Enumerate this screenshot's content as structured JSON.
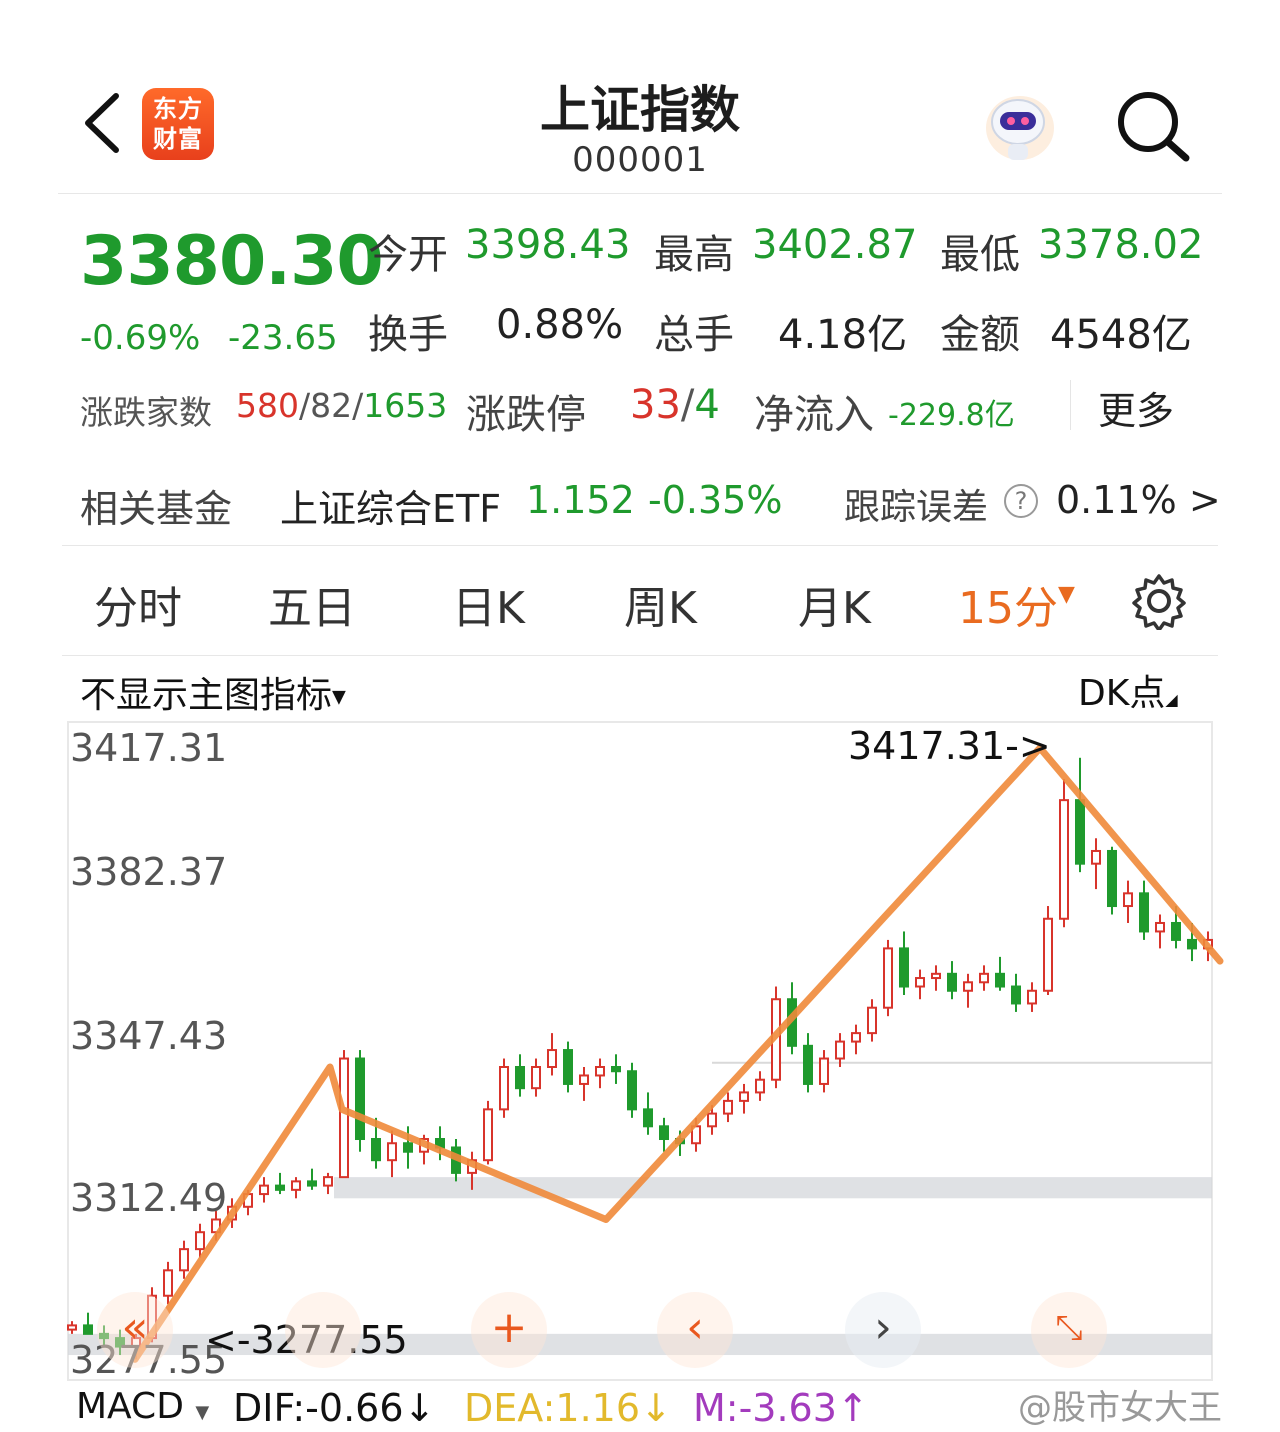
{
  "header": {
    "logo_text": "东方\n财富",
    "logo_line1": "东方",
    "logo_line2": "财富",
    "title": "上证指数",
    "code": "000001",
    "icons": [
      "back-arrow-icon",
      "robot-assistant-icon",
      "search-icon"
    ]
  },
  "quote": {
    "price": "3380.30",
    "pct": "-0.69%",
    "change": "-23.65",
    "open_label": "今开",
    "open": "3398.43",
    "high_label": "最高",
    "high": "3402.87",
    "low_label": "最低",
    "low": "3378.02",
    "turnover_label": "换手",
    "turnover": "0.88%",
    "volume_label": "总手",
    "volume": "4.18亿",
    "amount_label": "金额",
    "amount": "4548亿",
    "breadth_label": "涨跌家数",
    "breadth_up": "580",
    "breadth_flat": "/82/",
    "breadth_down": "1653",
    "limit_label": "涨跌停",
    "limit_up": "33",
    "limit_sep": "/",
    "limit_down": "4",
    "inflow_label": "净流入",
    "inflow": "-229.8亿",
    "more_label": "更多"
  },
  "fund": {
    "label": "相关基金",
    "name": "上证综合ETF",
    "price": "1.152",
    "change": "-0.35%",
    "tracking_label": "跟踪误差",
    "tracking_value": "0.11%",
    "arrow": ">"
  },
  "tabs": [
    {
      "label": "分时"
    },
    {
      "label": "五日"
    },
    {
      "label": "日K"
    },
    {
      "label": "周K"
    },
    {
      "label": "月K"
    },
    {
      "label": "15分",
      "active": true
    }
  ],
  "chart_header": {
    "indicator_select": "不显示主图指标",
    "dk_label": "DK点"
  },
  "chart_data": {
    "type": "candlestick",
    "interval": "15分",
    "y_ticks": [
      "3417.31",
      "3382.37",
      "3347.43",
      "3312.49",
      "3277.55"
    ],
    "ylim": [
      3277.55,
      3417.31
    ],
    "peak_label": "3417.31->",
    "low_label": "<-3277.55",
    "support_zones": [
      [
        3311,
        3316
      ],
      [
        3274,
        3279
      ]
    ],
    "zigzag_trend": [
      3273,
      3342,
      3332,
      3332,
      3306,
      3417.31,
      3367
    ],
    "candles": [
      [
        3280,
        3282,
        3279,
        3281
      ],
      [
        3281,
        3284,
        3280,
        3279
      ],
      [
        3279,
        3281,
        3276,
        3278
      ],
      [
        3278,
        3280,
        3274,
        3276
      ],
      [
        3276,
        3279,
        3273,
        3278
      ],
      [
        3278,
        3290,
        3277,
        3288
      ],
      [
        3288,
        3296,
        3286,
        3294
      ],
      [
        3294,
        3301,
        3292,
        3299
      ],
      [
        3299,
        3305,
        3297,
        3303
      ],
      [
        3303,
        3308,
        3301,
        3306
      ],
      [
        3306,
        3311,
        3304,
        3309
      ],
      [
        3309,
        3313,
        3307,
        3312
      ],
      [
        3312,
        3316,
        3310,
        3314
      ],
      [
        3314,
        3317,
        3312,
        3313
      ],
      [
        3313,
        3316,
        3311,
        3315
      ],
      [
        3315,
        3318,
        3313,
        3314
      ],
      [
        3314,
        3317,
        3312,
        3316
      ],
      [
        3316,
        3346,
        3316,
        3344
      ],
      [
        3344,
        3346,
        3322,
        3325
      ],
      [
        3325,
        3330,
        3318,
        3320
      ],
      [
        3320,
        3327,
        3316,
        3324
      ],
      [
        3324,
        3328,
        3318,
        3322
      ],
      [
        3322,
        3326,
        3319,
        3325
      ],
      [
        3325,
        3328,
        3320,
        3323
      ],
      [
        3323,
        3325,
        3315,
        3317
      ],
      [
        3317,
        3322,
        3313,
        3320
      ],
      [
        3320,
        3334,
        3319,
        3332
      ],
      [
        3332,
        3344,
        3330,
        3342
      ],
      [
        3342,
        3345,
        3335,
        3337
      ],
      [
        3337,
        3344,
        3335,
        3342
      ],
      [
        3342,
        3350,
        3340,
        3346
      ],
      [
        3346,
        3348,
        3336,
        3338
      ],
      [
        3338,
        3342,
        3334,
        3340
      ],
      [
        3340,
        3344,
        3337,
        3342
      ],
      [
        3342,
        3345,
        3338,
        3341
      ],
      [
        3341,
        3343,
        3330,
        3332
      ],
      [
        3332,
        3336,
        3326,
        3328
      ],
      [
        3328,
        3330,
        3322,
        3325
      ],
      [
        3325,
        3327,
        3321,
        3324
      ],
      [
        3324,
        3330,
        3322,
        3328
      ],
      [
        3328,
        3333,
        3326,
        3331
      ],
      [
        3331,
        3336,
        3329,
        3334
      ],
      [
        3334,
        3338,
        3331,
        3336
      ],
      [
        3336,
        3341,
        3334,
        3339
      ],
      [
        3339,
        3361,
        3337,
        3358
      ],
      [
        3358,
        3362,
        3345,
        3347
      ],
      [
        3347,
        3350,
        3336,
        3338
      ],
      [
        3338,
        3346,
        3336,
        3344
      ],
      [
        3344,
        3350,
        3342,
        3348
      ],
      [
        3348,
        3352,
        3345,
        3350
      ],
      [
        3350,
        3358,
        3348,
        3356
      ],
      [
        3356,
        3372,
        3354,
        3370
      ],
      [
        3370,
        3374,
        3359,
        3361
      ],
      [
        3361,
        3365,
        3358,
        3363
      ],
      [
        3363,
        3366,
        3360,
        3364
      ],
      [
        3364,
        3367,
        3358,
        3360
      ],
      [
        3360,
        3364,
        3356,
        3362
      ],
      [
        3362,
        3366,
        3360,
        3364
      ],
      [
        3364,
        3368,
        3360,
        3361
      ],
      [
        3361,
        3364,
        3355,
        3357
      ],
      [
        3357,
        3362,
        3355,
        3360
      ],
      [
        3360,
        3380,
        3359,
        3377
      ],
      [
        3377,
        3410,
        3375,
        3405
      ],
      [
        3405,
        3415,
        3388,
        3390
      ],
      [
        3390,
        3396,
        3384,
        3393
      ],
      [
        3393,
        3394,
        3378,
        3380
      ],
      [
        3380,
        3386,
        3376,
        3383
      ],
      [
        3383,
        3386,
        3372,
        3374
      ],
      [
        3374,
        3378,
        3370,
        3376
      ],
      [
        3376,
        3380,
        3370,
        3372
      ],
      [
        3372,
        3376,
        3367,
        3370
      ],
      [
        3370,
        3374,
        3367,
        3372
      ]
    ]
  },
  "toolbar_icons": [
    "fast-back-icon",
    "reset-icon",
    "plus-icon",
    "prev-icon",
    "next-icon",
    "fullscreen-icon"
  ],
  "macd": {
    "select": "MACD",
    "dif": "DIF:-0.66↓",
    "dea": "DEA:1.16↓",
    "m": "M:-3.63↑"
  },
  "watermark": "@股市女大王"
}
